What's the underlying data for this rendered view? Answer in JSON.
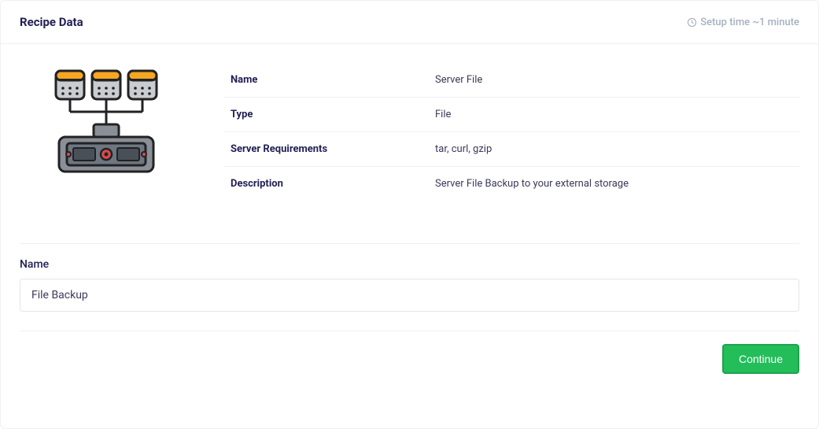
{
  "header": {
    "title": "Recipe Data",
    "setup_time": "Setup time ~1 minute"
  },
  "details": {
    "name_label": "Name",
    "name_value": "Server File",
    "type_label": "Type",
    "type_value": "File",
    "req_label": "Server Requirements",
    "req_value": "tar, curl, gzip",
    "desc_label": "Description",
    "desc_value": "Server File Backup to your external storage"
  },
  "form": {
    "name_label": "Name",
    "name_value": "File Backup"
  },
  "footer": {
    "continue_label": "Continue"
  }
}
